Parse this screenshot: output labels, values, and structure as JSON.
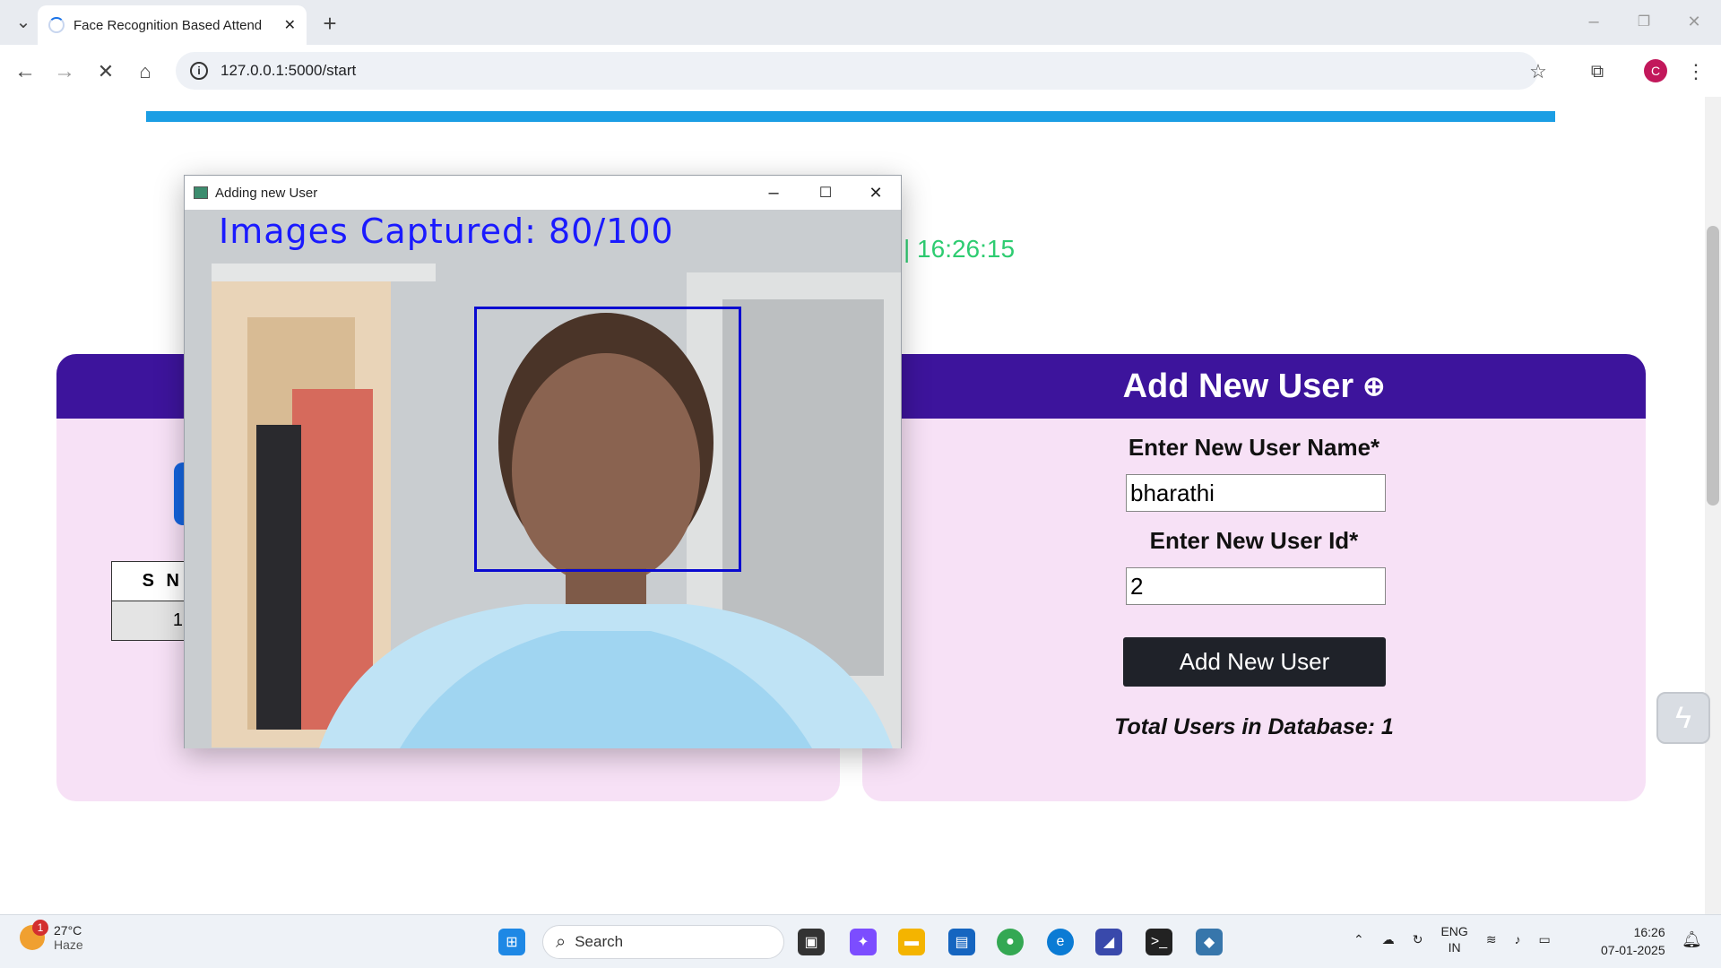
{
  "browser": {
    "tab_title": "Face Recognition Based Attend",
    "url": "127.0.0.1:5000/start",
    "profile_initial": "C"
  },
  "page": {
    "clock_text": "| 16:26:15",
    "add_user_panel": {
      "title": "Add New User",
      "name_label": "Enter New User Name*",
      "name_value": "bharathi",
      "id_label": "Enter New User Id*",
      "id_value": "2",
      "button_label": "Add New User",
      "total_users_text": "Total Users in Database: 1"
    },
    "attendance_table": {
      "header_fragment": "S N",
      "row_fragment": "1"
    }
  },
  "capture_window": {
    "title": "Adding new User",
    "caption": "Images Captured: 80/100"
  },
  "taskbar": {
    "weather_temp": "27°C",
    "weather_desc": "Haze",
    "weather_badge": "1",
    "search_placeholder": "Search",
    "lang_line1": "ENG",
    "lang_line2": "IN",
    "time": "16:26",
    "date": "07-01-2025"
  },
  "colors": {
    "panel_header": "#3d149c",
    "panel_body": "#f7e1f6",
    "clock": "#2ecc71",
    "top_line": "#1b9ee4",
    "face_box": "#0a0ad0"
  }
}
